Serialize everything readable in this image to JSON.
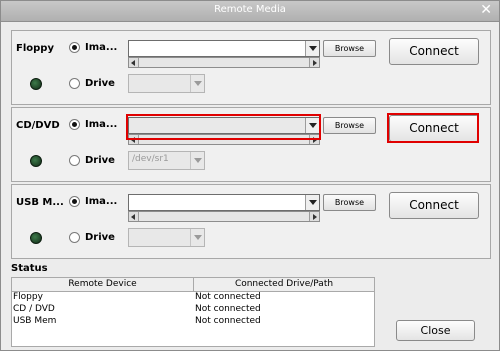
{
  "window": {
    "title": "Remote Media",
    "close_glyph": "✕"
  },
  "floppy": {
    "label": "Floppy",
    "image_label": "Ima...",
    "drive_label": "Drive",
    "image_path": "",
    "drive_value": "",
    "browse_label": "Browse",
    "connect_label": "Connect"
  },
  "cddvd": {
    "label": "CD/DVD",
    "image_label": "Ima...",
    "drive_label": "Drive",
    "image_path": "",
    "drive_value": "/dev/sr1",
    "browse_label": "Browse",
    "connect_label": "Connect"
  },
  "usb": {
    "label": "USB M...",
    "image_label": "Ima...",
    "drive_label": "Drive",
    "image_path": "",
    "drive_value": "",
    "browse_label": "Browse",
    "connect_label": "Connect"
  },
  "status": {
    "title": "Status",
    "columns": [
      "Remote Device",
      "Connected Drive/Path"
    ],
    "rows": [
      {
        "device": "Floppy",
        "path": "Not connected"
      },
      {
        "device": "CD / DVD",
        "path": "Not connected"
      },
      {
        "device": "USB Mem",
        "path": "Not connected"
      }
    ]
  },
  "footer": {
    "close_label": "Close"
  },
  "colors": {
    "highlight": "#e00000",
    "led": "#1f4a2a"
  }
}
